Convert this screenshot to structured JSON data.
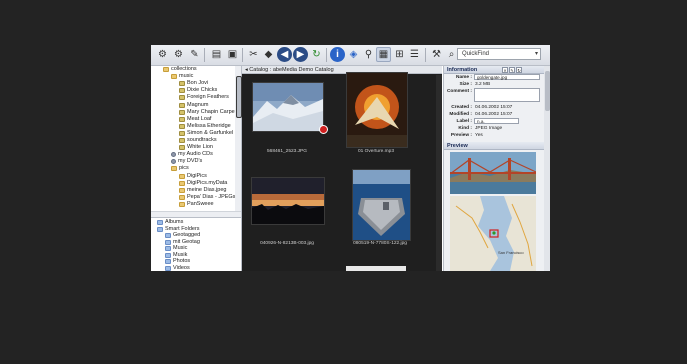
{
  "search": {
    "value": "QuickFind"
  },
  "breadcrumb": {
    "label": "◂ Catalog : abeMedia Demo Catalog"
  },
  "tree": {
    "items": [
      {
        "label": "collections",
        "icon": "folder-icon",
        "indent": 0
      },
      {
        "label": "music",
        "icon": "folder-icon",
        "indent": 1
      },
      {
        "label": "Bon Jovi",
        "icon": "song-icon",
        "indent": 2
      },
      {
        "label": "Dixie Chicks",
        "icon": "song-icon",
        "indent": 2
      },
      {
        "label": "Foreign Feathers",
        "icon": "song-icon",
        "indent": 2
      },
      {
        "label": "Magnum",
        "icon": "song-icon",
        "indent": 2
      },
      {
        "label": "Mary Chapin Carpe",
        "icon": "song-icon",
        "indent": 2
      },
      {
        "label": "Meat Loaf",
        "icon": "song-icon",
        "indent": 2
      },
      {
        "label": "Melissa Etheridge",
        "icon": "song-icon",
        "indent": 2
      },
      {
        "label": "Simon & Garfunkel",
        "icon": "song-icon",
        "indent": 2
      },
      {
        "label": "soundtracks",
        "icon": "song-icon",
        "indent": 2
      },
      {
        "label": "White Lion",
        "icon": "song-icon",
        "indent": 2
      },
      {
        "label": "my Audio CDs",
        "icon": "disc-icon",
        "indent": 1
      },
      {
        "label": "my DVD's",
        "icon": "disc-icon",
        "indent": 1
      },
      {
        "label": "pics",
        "icon": "folder-icon",
        "indent": 1
      },
      {
        "label": "DigiPics",
        "icon": "folder-icon",
        "indent": 2
      },
      {
        "label": "DigiPics.myData",
        "icon": "folder-icon",
        "indent": 2
      },
      {
        "label": "meine Dias.jpeg",
        "icon": "folder-icon",
        "indent": 2
      },
      {
        "label": "Pepa' Dias - JPEGs",
        "icon": "folder-icon",
        "indent": 2
      },
      {
        "label": "PanSweee",
        "icon": "folder-icon",
        "indent": 2
      }
    ]
  },
  "smart": {
    "items": [
      {
        "label": "Albums",
        "icon": "album-icon",
        "indent": 0
      },
      {
        "label": "Smart Folders",
        "icon": "smart-folder-icon",
        "indent": 0
      },
      {
        "label": "Geotagged",
        "icon": "smart-folder-icon",
        "indent": 1
      },
      {
        "label": "mit Geotag",
        "icon": "smart-folder-icon",
        "indent": 1
      },
      {
        "label": "Music",
        "icon": "smart-folder-icon",
        "indent": 1
      },
      {
        "label": "Musik",
        "icon": "smart-folder-icon",
        "indent": 1
      },
      {
        "label": "Photos",
        "icon": "smart-folder-icon",
        "indent": 1
      },
      {
        "label": "Videos",
        "icon": "smart-folder-icon",
        "indent": 1
      }
    ]
  },
  "thumbs": [
    {
      "caption": "568461_2523.JPG",
      "kind": "snow-mountain"
    },
    {
      "caption": "01 Overture.mp3",
      "kind": "star-trek-poster"
    },
    {
      "caption": "040926-N-8213B-003.jpg",
      "kind": "sunset-silhouette"
    },
    {
      "caption": "080519-N-7780S-122.jpg",
      "kind": "aircraft-carrier"
    }
  ],
  "info": {
    "title": "Information",
    "fields": [
      {
        "label": "Name :",
        "value": "goldengate.jpg",
        "boxed": true
      },
      {
        "label": "Size :",
        "value": "3.2 MB",
        "boxed": false
      },
      {
        "label": "Comment :",
        "value": "",
        "boxed": true
      },
      {
        "label": "Created :",
        "value": "04.06.2002 15:07",
        "boxed": false
      },
      {
        "label": "Modified :",
        "value": "04.06.2002 15:07",
        "boxed": false
      },
      {
        "label": "Label :",
        "value": "n.a.",
        "boxed": true
      },
      {
        "label": "Kind :",
        "value": "JPEG Image",
        "boxed": false
      },
      {
        "label": "Preview :",
        "value": "Yes",
        "boxed": false
      }
    ]
  },
  "preview": {
    "title": "Preview"
  },
  "map": {
    "label": "San Francisco"
  },
  "colors": {
    "accent": "#2a64c8",
    "window_bg": "#232323"
  }
}
